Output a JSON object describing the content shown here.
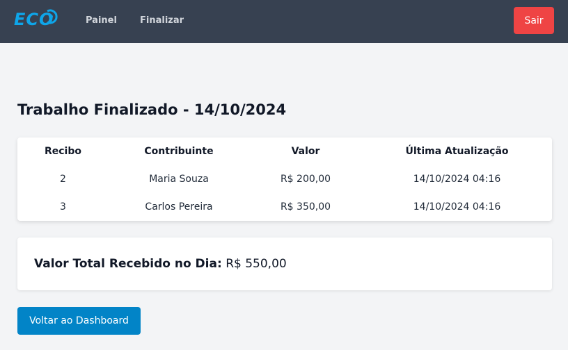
{
  "header": {
    "logo_text": "ECO",
    "brand_color": "#0ea5e9",
    "nav": [
      {
        "label": "Painel"
      },
      {
        "label": "Finalizar"
      }
    ],
    "logout_label": "Sair",
    "logout_color": "#ef4444"
  },
  "main": {
    "title": "Trabalho Finalizado - 14/10/2024",
    "table": {
      "columns": [
        "Recibo",
        "Contribuinte",
        "Valor",
        "Última Atualização"
      ],
      "rows": [
        {
          "recibo": "2",
          "contribuinte": "Maria Souza",
          "valor": "R$ 200,00",
          "atualizacao": "14/10/2024 04:16"
        },
        {
          "recibo": "3",
          "contribuinte": "Carlos Pereira",
          "valor": "R$ 350,00",
          "atualizacao": "14/10/2024 04:16"
        }
      ]
    },
    "total": {
      "label": "Valor Total Recebido no Dia:",
      "value": "R$ 550,00"
    },
    "back_button_label": "Voltar ao Dashboard",
    "back_button_color": "#0284c7"
  }
}
